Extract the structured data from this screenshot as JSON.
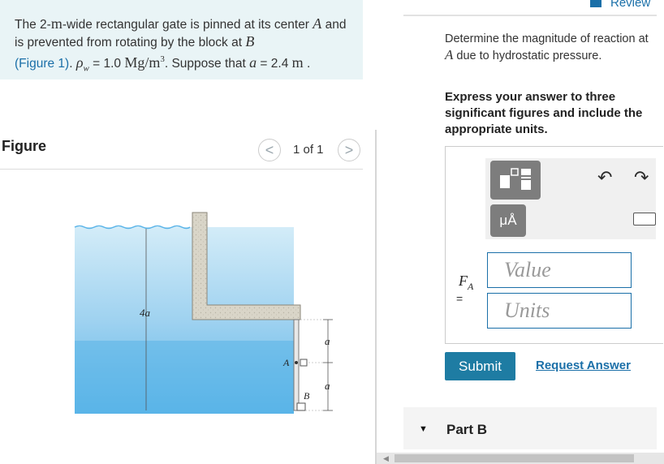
{
  "problem": {
    "part1": "The 2-",
    "m": "m",
    "part2": "-wide rectangular gate is pinned at its center ",
    "A": "A",
    "part3": "and is prevented from rotating by the block at ",
    "B": "B",
    "figure_link": "(Figure 1)",
    "part4": ". ",
    "rho": "ρ",
    "rho_sub": "w",
    "part5": " = 1.0 ",
    "units": "Mg/m",
    "cube": "3",
    "part6": ". Suppose that ",
    "a": "a",
    "part7": " = 2.4 ",
    "m2": "m",
    "part8": " ."
  },
  "figure": {
    "title": "Figure",
    "counter": "1 of 1",
    "prev": "<",
    "next": ">",
    "labels": {
      "depth": "4a",
      "a_top": "a",
      "a_bottom": "a",
      "A": "A",
      "B": "B"
    }
  },
  "review": {
    "label": "Review"
  },
  "question": {
    "text": "Determine the magnitude of reaction at ",
    "A": "A",
    "text2": " due to hydrostatic pressure."
  },
  "instructions": "Express your answer to three significant figures and include the appropriate units.",
  "answer": {
    "units_button": "μÅ",
    "undo": "↶",
    "redo": "↷",
    "symbol": "F",
    "symbol_sub": "A",
    "equals": "=",
    "value_placeholder": "Value",
    "units_placeholder": "Units"
  },
  "actions": {
    "submit": "Submit",
    "request": "Request Answer"
  },
  "part_b": {
    "label": "Part B"
  },
  "colors": {
    "accent": "#1a6fa8",
    "submit_bg": "#1e7ca3",
    "water_top": "#bfe3f5",
    "water_bottom": "#5ab4e8",
    "problem_bg": "#e9f4f6"
  }
}
